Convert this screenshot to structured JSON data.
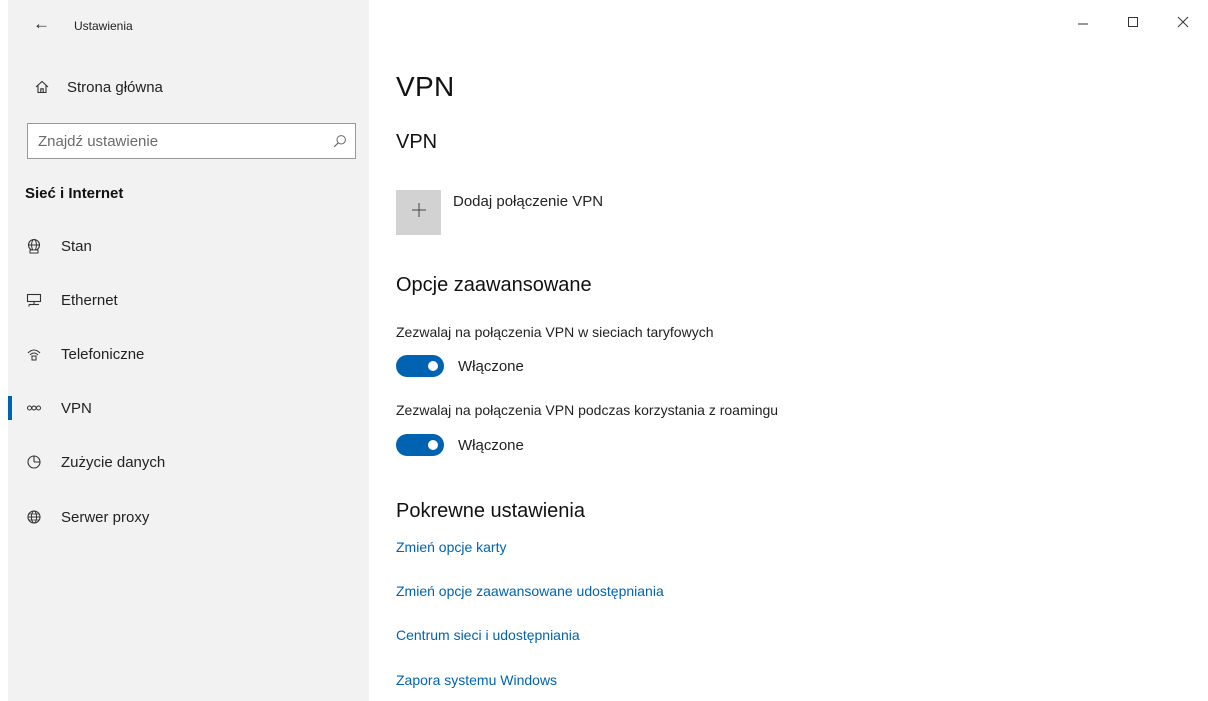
{
  "titlebar": {
    "back_icon": "back-arrow-icon",
    "title": "Ustawienia",
    "controls": [
      "minimize-icon",
      "maximize-icon",
      "close-icon"
    ]
  },
  "sidebar": {
    "home_label": "Strona główna",
    "search": {
      "placeholder": "Znajdź ustawienie",
      "value": ""
    },
    "section_heading": "Sieć i Internet",
    "items": [
      {
        "label": "Stan",
        "icon": "status-globe-icon",
        "selected": false
      },
      {
        "label": "Ethernet",
        "icon": "ethernet-icon",
        "selected": false
      },
      {
        "label": "Telefoniczne",
        "icon": "dialup-icon",
        "selected": false
      },
      {
        "label": "VPN",
        "icon": "vpn-icon",
        "selected": true
      },
      {
        "label": "Zużycie danych",
        "icon": "data-usage-icon",
        "selected": false
      },
      {
        "label": "Serwer proxy",
        "icon": "globe-icon",
        "selected": false
      }
    ]
  },
  "main": {
    "page_title": "VPN",
    "section_title": "VPN",
    "add_vpn_label": "Dodaj połączenie VPN",
    "advanced_title": "Opcje zaawansowane",
    "settings": [
      {
        "label": "Zezwalaj na połączenia VPN w sieciach taryfowych",
        "state": "Włączone",
        "on": true
      },
      {
        "label": "Zezwalaj na połączenia VPN podczas korzystania z roamingu",
        "state": "Włączone",
        "on": true
      }
    ],
    "related_title": "Pokrewne ustawienia",
    "links": [
      "Zmień opcje karty",
      "Zmień opcje zaawansowane udostępniania",
      "Centrum sieci i udostępniania",
      "Zapora systemu Windows"
    ]
  },
  "colors": {
    "accent": "#0063b1",
    "sidebar_bg": "#f2f2f2",
    "tile_bg": "#d2d2d2"
  }
}
